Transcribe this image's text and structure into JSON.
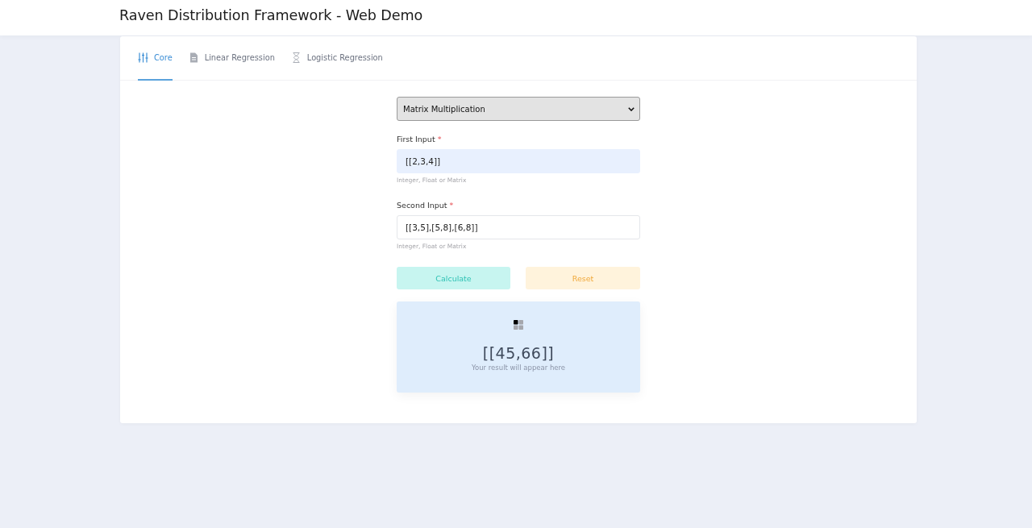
{
  "header": {
    "title": "Raven Distribution Framework - Web Demo"
  },
  "tabs": [
    {
      "label": "Core",
      "selected": true
    },
    {
      "label": "Linear Regression",
      "selected": false
    },
    {
      "label": "Logistic Regression",
      "selected": false
    }
  ],
  "operation": {
    "value": "Matrix Multiplication"
  },
  "fields": [
    {
      "label": "First Input",
      "required_mark": "*",
      "value": "[[2,3,4]]",
      "hint": "Integer, Float or Matrix",
      "highlighted": true
    },
    {
      "label": "Second Input",
      "required_mark": "*",
      "value": "[[3,5],[5,8],[6,8]]",
      "hint": "Integer, Float or Matrix",
      "highlighted": false
    }
  ],
  "buttons": [
    {
      "label": "Calculate",
      "kind": "primary"
    },
    {
      "label": "Reset",
      "kind": "warning"
    }
  ],
  "result": {
    "value": "[[45,66]]",
    "caption": "Your result will appear here"
  }
}
